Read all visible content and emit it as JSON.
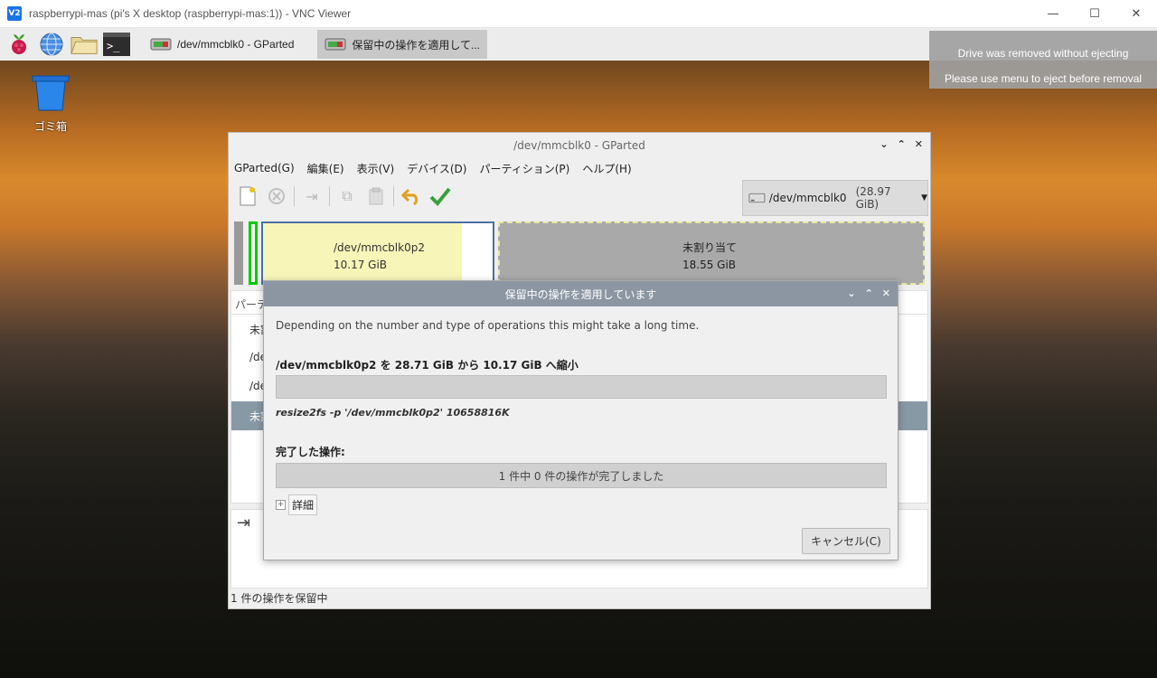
{
  "vnc": {
    "logo": "V2",
    "title": "raspberrypi-mas (pi's X desktop (raspberrypi-mas:1)) - VNC Viewer",
    "controls": [
      "minimize-icon",
      "maximize-icon",
      "close-icon"
    ]
  },
  "taskbar": {
    "launchers": [
      "raspberry-menu-icon",
      "browser-globe-icon",
      "file-manager-icon",
      "terminal-icon"
    ],
    "tasks": [
      {
        "label": "/dev/mmcblk0 - GParted",
        "active": false
      },
      {
        "label": "保留中の操作を適用して...",
        "active": true
      }
    ]
  },
  "notification": {
    "line1": "Drive was removed without ejecting",
    "line2": "Please use menu to eject before removal"
  },
  "desktop": {
    "trash_label": "ゴミ箱"
  },
  "gparted": {
    "title": "/dev/mmcblk0 - GParted",
    "menu": [
      "GParted(G)",
      "編集(E)",
      "表示(V)",
      "デバイス(D)",
      "パーティション(P)",
      "ヘルプ(H)"
    ],
    "device": {
      "name": "/dev/mmcblk0",
      "size": "(28.97 GiB)"
    },
    "partitions": [
      {
        "name": "/dev/mmcblk0p2",
        "size": "10.17 GiB"
      },
      {
        "name": "未割り当て",
        "size": "18.55 GiB"
      }
    ],
    "list_header": "パーティ",
    "list_rows": [
      {
        "label": "未割",
        "selected": false
      },
      {
        "label": "/dev",
        "selected": false
      },
      {
        "label": "/dev",
        "selected": false
      },
      {
        "label": "未割",
        "selected": true
      }
    ],
    "status": "1 件の操作を保留中"
  },
  "dialog": {
    "title": "保留中の操作を適用しています",
    "description": "Depending on the number and type of operations this might take a long time.",
    "operation": "/dev/mmcblk0p2 を 28.71 GiB から 10.17 GiB へ縮小",
    "command": "resize2fs -p '/dev/mmcblk0p2' 10658816K",
    "completed_heading": "完了した操作:",
    "completed_text": "1 件中 0 件の操作が完了しました",
    "completed_fraction": 0,
    "details_label": "詳細",
    "cancel_label": "キャンセル(C)"
  }
}
